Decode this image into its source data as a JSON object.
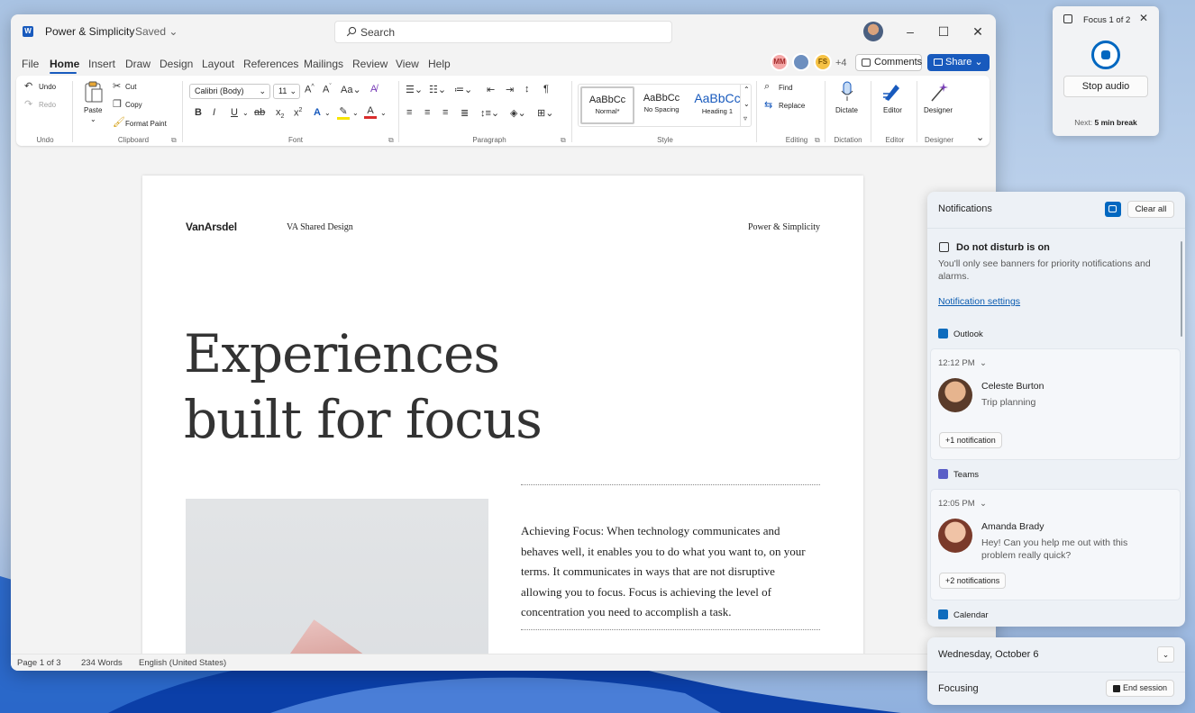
{
  "word": {
    "doc_title": "Power & Simplicity",
    "saved_status": "Saved",
    "search_placeholder": "Search",
    "menu": [
      "File",
      "Home",
      "Insert",
      "Draw",
      "Design",
      "Layout",
      "References",
      "Mailings",
      "Review",
      "View",
      "Help"
    ],
    "active_menu": "Home",
    "collaborators": [
      {
        "initials": "MM",
        "color": "#f4a7a7"
      },
      {
        "initials": "",
        "color": "#6d8fbf"
      },
      {
        "initials": "FS",
        "color": "#f6c244"
      }
    ],
    "more_collaborators": "+4",
    "comments_label": "Comments",
    "share_label": "Share",
    "accent": "#185abd"
  },
  "ribbon": {
    "undo": "Undo",
    "redo": "Redo",
    "paste": "Paste",
    "cut": "Cut",
    "copy": "Copy",
    "format_paint": "Format Paint",
    "font_name": "Calibri (Body)",
    "font_size": "11",
    "styles": [
      {
        "sample": "AaBbCc",
        "name": "Normal*"
      },
      {
        "sample": "AaBbCc",
        "name": "No Spacing"
      },
      {
        "sample": "AaBbCc",
        "name": "Heading 1"
      }
    ],
    "find": "Find",
    "replace": "Replace",
    "dictate": "Dictate",
    "editor": "Editor",
    "designer": "Designer",
    "groups": [
      "Undo",
      "Clipboard",
      "Font",
      "Paragraph",
      "Style",
      "Editing",
      "Dictation",
      "Editor",
      "Designer"
    ]
  },
  "document": {
    "logo": "VanArsdel",
    "header_mid": "VA Shared Design",
    "header_right": "Power & Simplicity",
    "heading_line1": "Experiences",
    "heading_line2": "built for focus",
    "body": "Achieving Focus: When technology communicates and behaves well, it enables you to do what you want to, on your terms. It communicates in ways that are not disruptive allowing you to focus. Focus is achieving the level of concentration you need to accomplish a task."
  },
  "status_bar": {
    "page": "Page 1 of 3",
    "words": "234 Words",
    "language": "English (United States)"
  },
  "focus": {
    "title": "Focus 1 of 2",
    "stop_audio": "Stop audio",
    "next_label": "Next:",
    "next_value": "5 min break",
    "accent": "#0067c0"
  },
  "notifications": {
    "title": "Notifications",
    "clear_all": "Clear all",
    "dnd_title": "Do not disturb is on",
    "dnd_desc": "You'll only see banners for priority notifications and alarms.",
    "settings_link": "Notification settings",
    "apps": [
      {
        "name": "Outlook",
        "color": "#0f6cbd",
        "time": "12:12 PM",
        "sender": "Celeste Burton",
        "message": "Trip planning",
        "more": "+1 notification"
      },
      {
        "name": "Teams",
        "color": "#5b5fc7",
        "time": "12:05 PM",
        "sender": "Amanda Brady",
        "message": "Hey! Can you help me out with this problem really quick?",
        "more": "+2 notifications"
      },
      {
        "name": "Calendar",
        "color": "#0f6cbd"
      }
    ]
  },
  "calendar": {
    "date": "Wednesday, October 6",
    "focusing": "Focusing",
    "end_session": "End session"
  }
}
